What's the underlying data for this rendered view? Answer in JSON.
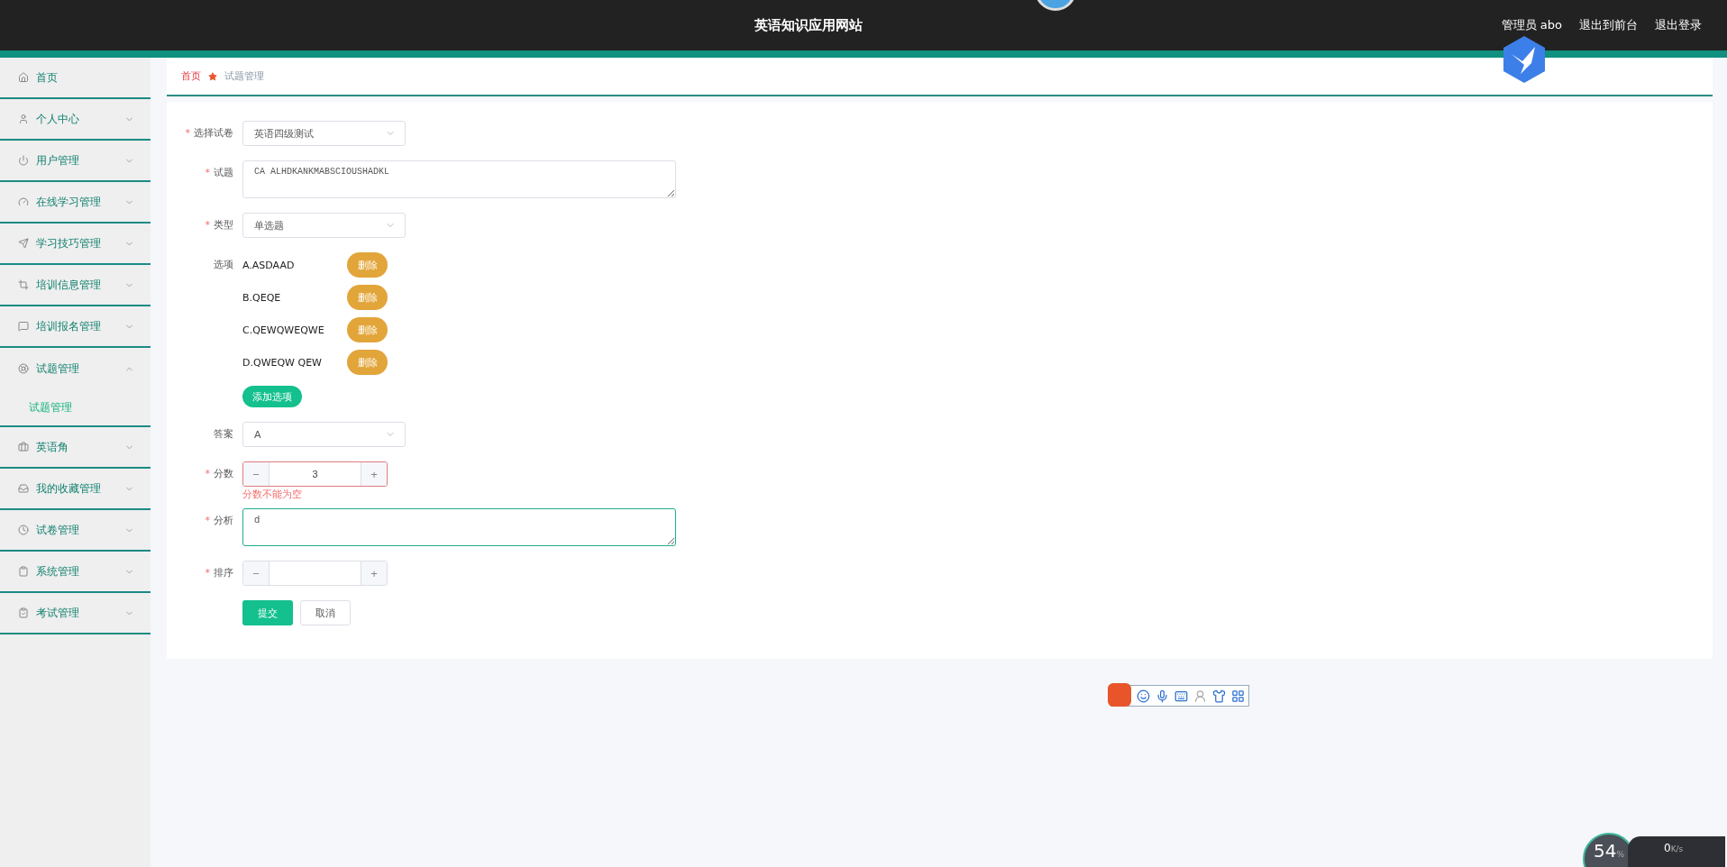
{
  "header": {
    "title": "英语知识应用网站",
    "links": [
      "管理员 abo",
      "退出到前台",
      "退出登录"
    ]
  },
  "sidebar": {
    "items": [
      {
        "label": "首页"
      },
      {
        "label": "个人中心",
        "expanded": false
      },
      {
        "label": "用户管理",
        "expanded": false
      },
      {
        "label": "在线学习管理",
        "expanded": false
      },
      {
        "label": "学习技巧管理",
        "expanded": false
      },
      {
        "label": "培训信息管理",
        "expanded": false
      },
      {
        "label": "培训报名管理",
        "expanded": false
      },
      {
        "label": "试题管理",
        "expanded": true,
        "children": [
          {
            "label": "试题管理",
            "selected": true
          }
        ]
      },
      {
        "label": "英语角",
        "expanded": false
      },
      {
        "label": "我的收藏管理",
        "expanded": false
      },
      {
        "label": "试卷管理",
        "expanded": false
      },
      {
        "label": "系统管理",
        "expanded": false
      },
      {
        "label": "考试管理",
        "expanded": false
      }
    ]
  },
  "breadcrumb": [
    "首页",
    "试题管理"
  ],
  "form": {
    "paper": {
      "label": "选择试卷",
      "required_mark": "*",
      "value": "英语四级测试"
    },
    "question": {
      "label": "试题",
      "required_mark": "*",
      "value": "CA ALHDKANKMABSCIOUSHADKL"
    },
    "type": {
      "label": "类型",
      "required_mark": "*",
      "value": "单选题"
    },
    "options": {
      "label": "选项",
      "items": [
        {
          "text": "A.ASDAAD",
          "button": "删除"
        },
        {
          "text": "B.QEQE",
          "button": "删除"
        },
        {
          "text": "C.QEWQWEQWE",
          "button": "删除"
        },
        {
          "text": "D.QWEQW QEW",
          "button": "删除"
        }
      ],
      "add_button": "添加选项"
    },
    "answer": {
      "label": "答案",
      "value": "A"
    },
    "score": {
      "label": "分数",
      "required_mark": "*",
      "value": "3",
      "minus": "−",
      "plus": "+",
      "error": "分数不能为空"
    },
    "analysis": {
      "label": "分析",
      "required_mark": "*",
      "value": "d",
      "focused": true
    },
    "order": {
      "label": "排序",
      "required_mark": "*",
      "minus": "−",
      "plus": "+"
    },
    "submit": "提交",
    "cancel": "取消"
  },
  "net_meter": {
    "percent": "54",
    "percent_unit": "%",
    "speed": "0",
    "speed_unit": "K/s"
  }
}
